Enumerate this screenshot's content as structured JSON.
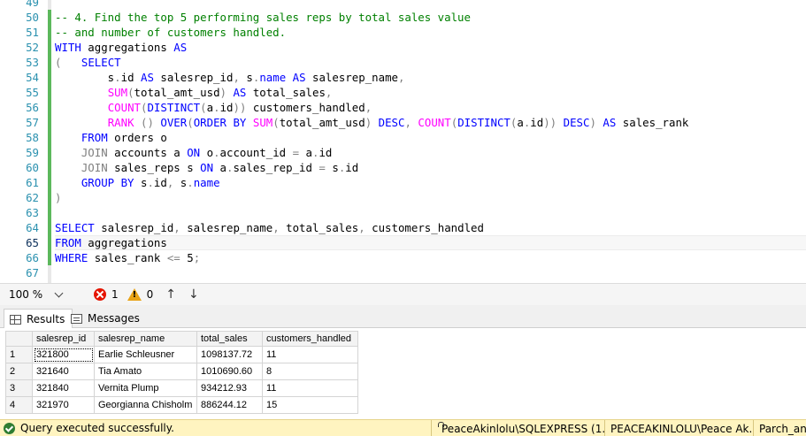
{
  "editor": {
    "saved_bar_color": "#5cb85c",
    "lines": [
      {
        "num": "49",
        "tokens": []
      },
      {
        "num": "50",
        "tokens": [
          {
            "t": "comment",
            "v": "-- 4. Find the top 5 performing sales reps by total sales value"
          }
        ]
      },
      {
        "num": "51",
        "tokens": [
          {
            "t": "comment",
            "v": "-- and number of customers handled."
          }
        ]
      },
      {
        "num": "52",
        "tokens": [
          {
            "t": "keyword",
            "v": "WITH"
          },
          {
            "t": "text",
            "v": " aggregations "
          },
          {
            "t": "keyword",
            "v": "AS"
          }
        ]
      },
      {
        "num": "53",
        "tokens": [
          {
            "t": "operator",
            "v": "("
          },
          {
            "t": "text",
            "v": "   "
          },
          {
            "t": "keyword",
            "v": "SELECT"
          }
        ]
      },
      {
        "num": "54",
        "tokens": [
          {
            "t": "text",
            "v": "        s"
          },
          {
            "t": "operator",
            "v": "."
          },
          {
            "t": "text",
            "v": "id "
          },
          {
            "t": "keyword",
            "v": "AS"
          },
          {
            "t": "text",
            "v": " salesrep_id"
          },
          {
            "t": "operator",
            "v": ","
          },
          {
            "t": "text",
            "v": " s"
          },
          {
            "t": "operator",
            "v": "."
          },
          {
            "t": "keyword",
            "v": "name"
          },
          {
            "t": "text",
            "v": " "
          },
          {
            "t": "keyword",
            "v": "AS"
          },
          {
            "t": "text",
            "v": " salesrep_name"
          },
          {
            "t": "operator",
            "v": ","
          }
        ]
      },
      {
        "num": "55",
        "tokens": [
          {
            "t": "text",
            "v": "        "
          },
          {
            "t": "function",
            "v": "SUM"
          },
          {
            "t": "operator",
            "v": "("
          },
          {
            "t": "text",
            "v": "total_amt_usd"
          },
          {
            "t": "operator",
            "v": ")"
          },
          {
            "t": "text",
            "v": " "
          },
          {
            "t": "keyword",
            "v": "AS"
          },
          {
            "t": "text",
            "v": " total_sales"
          },
          {
            "t": "operator",
            "v": ","
          }
        ]
      },
      {
        "num": "56",
        "tokens": [
          {
            "t": "text",
            "v": "        "
          },
          {
            "t": "function",
            "v": "COUNT"
          },
          {
            "t": "operator",
            "v": "("
          },
          {
            "t": "keyword",
            "v": "DISTINCT"
          },
          {
            "t": "operator",
            "v": "("
          },
          {
            "t": "text",
            "v": "a"
          },
          {
            "t": "operator",
            "v": "."
          },
          {
            "t": "text",
            "v": "id"
          },
          {
            "t": "operator",
            "v": "))"
          },
          {
            "t": "text",
            "v": " customers_handled"
          },
          {
            "t": "operator",
            "v": ","
          }
        ]
      },
      {
        "num": "57",
        "tokens": [
          {
            "t": "text",
            "v": "        "
          },
          {
            "t": "function",
            "v": "RANK"
          },
          {
            "t": "text",
            "v": " "
          },
          {
            "t": "operator",
            "v": "()"
          },
          {
            "t": "text",
            "v": " "
          },
          {
            "t": "keyword",
            "v": "OVER"
          },
          {
            "t": "operator",
            "v": "("
          },
          {
            "t": "keyword",
            "v": "ORDER BY"
          },
          {
            "t": "text",
            "v": " "
          },
          {
            "t": "function",
            "v": "SUM"
          },
          {
            "t": "operator",
            "v": "("
          },
          {
            "t": "text",
            "v": "total_amt_usd"
          },
          {
            "t": "operator",
            "v": ")"
          },
          {
            "t": "text",
            "v": " "
          },
          {
            "t": "keyword",
            "v": "DESC"
          },
          {
            "t": "operator",
            "v": ","
          },
          {
            "t": "text",
            "v": " "
          },
          {
            "t": "function",
            "v": "COUNT"
          },
          {
            "t": "operator",
            "v": "("
          },
          {
            "t": "keyword",
            "v": "DISTINCT"
          },
          {
            "t": "operator",
            "v": "("
          },
          {
            "t": "text",
            "v": "a"
          },
          {
            "t": "operator",
            "v": "."
          },
          {
            "t": "text",
            "v": "id"
          },
          {
            "t": "operator",
            "v": "))"
          },
          {
            "t": "text",
            "v": " "
          },
          {
            "t": "keyword",
            "v": "DESC"
          },
          {
            "t": "operator",
            "v": ")"
          },
          {
            "t": "text",
            "v": " "
          },
          {
            "t": "keyword",
            "v": "AS"
          },
          {
            "t": "text",
            "v": " sales_rank"
          }
        ]
      },
      {
        "num": "58",
        "tokens": [
          {
            "t": "text",
            "v": "    "
          },
          {
            "t": "keyword",
            "v": "FROM"
          },
          {
            "t": "text",
            "v": " orders o"
          }
        ]
      },
      {
        "num": "59",
        "tokens": [
          {
            "t": "text",
            "v": "    "
          },
          {
            "t": "operator",
            "v": "JOIN"
          },
          {
            "t": "text",
            "v": " accounts a "
          },
          {
            "t": "keyword",
            "v": "ON"
          },
          {
            "t": "text",
            "v": " o"
          },
          {
            "t": "operator",
            "v": "."
          },
          {
            "t": "text",
            "v": "account_id "
          },
          {
            "t": "operator",
            "v": "="
          },
          {
            "t": "text",
            "v": " a"
          },
          {
            "t": "operator",
            "v": "."
          },
          {
            "t": "text",
            "v": "id"
          }
        ]
      },
      {
        "num": "60",
        "tokens": [
          {
            "t": "text",
            "v": "    "
          },
          {
            "t": "operator",
            "v": "JOIN"
          },
          {
            "t": "text",
            "v": " sales_reps s "
          },
          {
            "t": "keyword",
            "v": "ON"
          },
          {
            "t": "text",
            "v": " a"
          },
          {
            "t": "operator",
            "v": "."
          },
          {
            "t": "text",
            "v": "sales_rep_id "
          },
          {
            "t": "operator",
            "v": "="
          },
          {
            "t": "text",
            "v": " s"
          },
          {
            "t": "operator",
            "v": "."
          },
          {
            "t": "text",
            "v": "id"
          }
        ]
      },
      {
        "num": "61",
        "tokens": [
          {
            "t": "text",
            "v": "    "
          },
          {
            "t": "keyword",
            "v": "GROUP BY"
          },
          {
            "t": "text",
            "v": " s"
          },
          {
            "t": "operator",
            "v": "."
          },
          {
            "t": "text",
            "v": "id"
          },
          {
            "t": "operator",
            "v": ","
          },
          {
            "t": "text",
            "v": " s"
          },
          {
            "t": "operator",
            "v": "."
          },
          {
            "t": "keyword",
            "v": "name"
          }
        ]
      },
      {
        "num": "62",
        "tokens": [
          {
            "t": "operator",
            "v": ")"
          }
        ]
      },
      {
        "num": "63",
        "tokens": []
      },
      {
        "num": "64",
        "tokens": [
          {
            "t": "keyword",
            "v": "SELECT"
          },
          {
            "t": "text",
            "v": " salesrep_id"
          },
          {
            "t": "operator",
            "v": ","
          },
          {
            "t": "text",
            "v": " salesrep_name"
          },
          {
            "t": "operator",
            "v": ","
          },
          {
            "t": "text",
            "v": " total_sales"
          },
          {
            "t": "operator",
            "v": ","
          },
          {
            "t": "text",
            "v": " customers_handled"
          }
        ]
      },
      {
        "num": "65",
        "current": true,
        "tokens": [
          {
            "t": "keyword",
            "v": "FROM"
          },
          {
            "t": "text",
            "v": " aggregations"
          }
        ]
      },
      {
        "num": "66",
        "tokens": [
          {
            "t": "keyword",
            "v": "WHERE"
          },
          {
            "t": "text",
            "v": " sales_rank "
          },
          {
            "t": "operator",
            "v": "<="
          },
          {
            "t": "text",
            "v": " 5"
          },
          {
            "t": "operator",
            "v": ";"
          }
        ]
      },
      {
        "num": "67",
        "tokens": []
      }
    ]
  },
  "editor_status": {
    "zoom": "100 %",
    "error_count": "1",
    "warning_count": "0"
  },
  "results_tabs": {
    "results_label": "Results",
    "messages_label": "Messages"
  },
  "results": {
    "columns": [
      "salesrep_id",
      "salesrep_name",
      "total_sales",
      "customers_handled"
    ],
    "rows": [
      {
        "n": "1",
        "cells": [
          "321800",
          "Earlie Schleusner",
          "1098137.72",
          "11"
        ]
      },
      {
        "n": "2",
        "cells": [
          "321640",
          "Tia Amato",
          "1010690.60",
          "8"
        ]
      },
      {
        "n": "3",
        "cells": [
          "321840",
          "Vernita Plump",
          "934212.93",
          "11"
        ]
      },
      {
        "n": "4",
        "cells": [
          "321970",
          "Georgianna Chisholm",
          "886244.12",
          "15"
        ]
      }
    ]
  },
  "statusbar": {
    "message": "Query executed successfully.",
    "server": "PeaceAkinlolu\\SQLEXPRESS (1...",
    "user": "PEACEAKINLOLU\\Peace Ak...",
    "database": "Parch_and_"
  }
}
